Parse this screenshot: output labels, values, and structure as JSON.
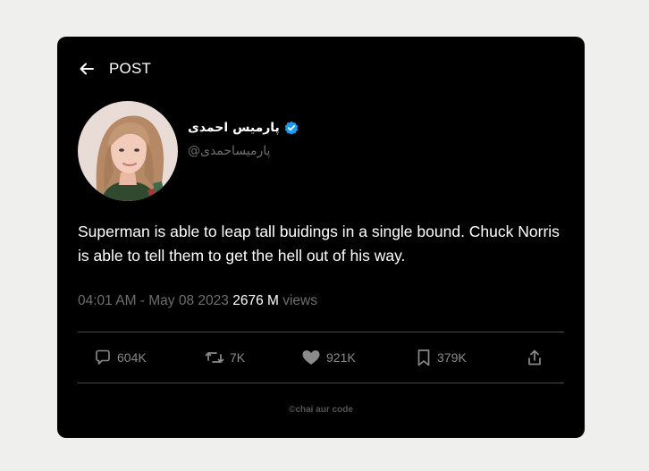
{
  "header": {
    "title": "POST",
    "back_icon": "arrow-left-icon"
  },
  "user": {
    "display_name": "پارمیس احمدی",
    "handle": "پارمیساحمدی@",
    "verified_icon": "verified-badge-icon",
    "verified_color": "#1d9bf0"
  },
  "tweet": {
    "text": "Superman is able to leap tall buidings in a single bound. Chuck Norris is able to tell them to get the hell out of his way.",
    "timestamp": "04:01 AM - May 08 2023",
    "views_count": "2676 M",
    "views_label": "views"
  },
  "actions": {
    "replies": {
      "icon": "comment-icon",
      "count": "604K"
    },
    "retweets": {
      "icon": "retweet-icon",
      "count": "7K"
    },
    "likes": {
      "icon": "heart-icon",
      "count": "921K"
    },
    "bookmarks": {
      "icon": "bookmark-icon",
      "count": "379K"
    },
    "share": {
      "icon": "share-icon"
    }
  },
  "footer": {
    "text": "©chai aur code"
  },
  "colors": {
    "page_background": "#efefee",
    "card_background": "#000000",
    "muted_text": "#6e6e6e",
    "icon_gray": "#8a8a8a"
  }
}
